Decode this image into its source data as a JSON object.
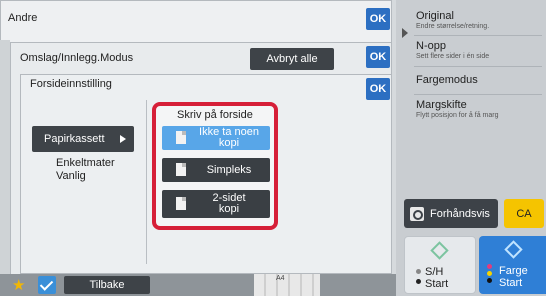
{
  "dialogs": {
    "level1": {
      "title": "Andre",
      "ok": "OK"
    },
    "level2": {
      "title": "Omslag/Innlegg.Modus",
      "cancel_all": "Avbryt alle",
      "ok": "OK"
    },
    "level3": {
      "title": "Forsideinnstilling",
      "ok": "OK"
    }
  },
  "paper": {
    "button": "Papirkassett",
    "info_line1": "Enkeltmater",
    "info_line2": "Vanlig"
  },
  "print_on_cover": {
    "title": "Skriv på forside",
    "options": [
      {
        "label": "Ikke ta noen kopi",
        "selected": true
      },
      {
        "label": "Simpleks",
        "selected": false
      },
      {
        "label_line1": "2-sidet",
        "label_line2": "kopi",
        "selected": false
      }
    ]
  },
  "side_panel": {
    "items": [
      {
        "title": "Original",
        "sub": "Endre størrelse/retning."
      },
      {
        "title": "N-opp",
        "sub": "Sett flere sider i én side"
      },
      {
        "title": "Fargemodus",
        "sub": ""
      },
      {
        "title": "Margskifte",
        "sub": "Flytt posisjon for å få marg"
      }
    ],
    "preview": "Forhåndsvis",
    "clear_all": "CA",
    "start_bw_line1": "S/H",
    "start_bw_line2": "Start",
    "start_color_line1": "Farge",
    "start_color_line2": "Start"
  },
  "bottom": {
    "back": "Tilbake",
    "paper_size": "A4"
  },
  "colors": {
    "accent_blue": "#2c6fc2",
    "selected_option": "#58a6e8",
    "highlight_frame": "#d61f38",
    "clear_all": "#f5c400",
    "color_start": "#2f7fd6"
  }
}
